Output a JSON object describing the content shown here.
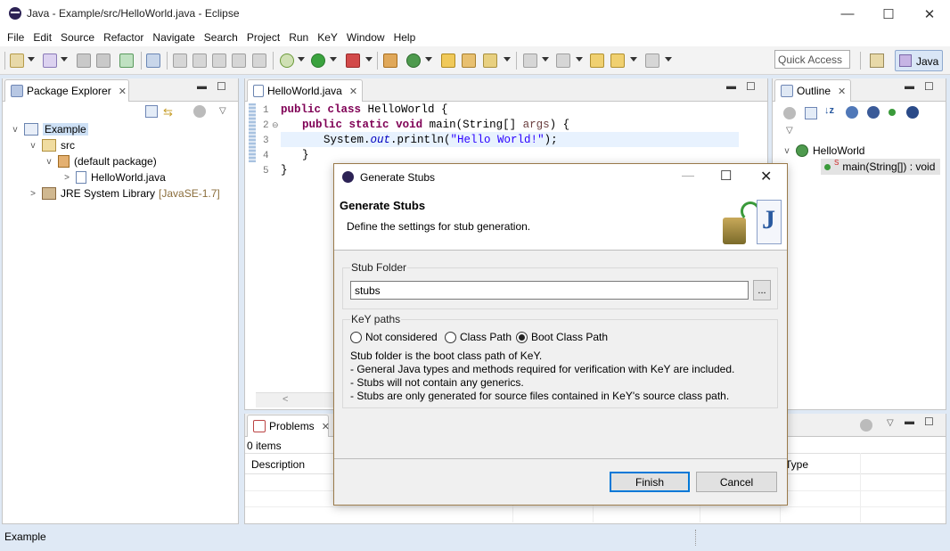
{
  "window": {
    "title": "Java - Example/src/HelloWorld.java - Eclipse",
    "minimize": "—",
    "maximize": "☐",
    "close": "✕"
  },
  "menu": [
    "File",
    "Edit",
    "Source",
    "Refactor",
    "Navigate",
    "Search",
    "Project",
    "Run",
    "KeY",
    "Window",
    "Help"
  ],
  "toolbar": {
    "quick_access_placeholder": "Quick Access",
    "perspective_label": "Java"
  },
  "package_explorer": {
    "tab_label": "Package Explorer",
    "tree": {
      "project": "Example",
      "src": "src",
      "package": "(default package)",
      "file": "HelloWorld.java",
      "jre": "JRE System Library",
      "jre_version": "[JavaSE-1.7]"
    }
  },
  "editor": {
    "tab_label": "HelloWorld.java",
    "line_numbers": [
      "1",
      "2",
      "3",
      "4",
      "5"
    ],
    "lines": {
      "l1_kw1": "public",
      "l1_kw2": "class",
      "l1_rest": " HelloWorld {",
      "l2_kw1": "public",
      "l2_kw2": "static",
      "l2_kw3": "void",
      "l2_mid": " main(String[] ",
      "l2_arg": "args",
      "l2_rest": ") {",
      "l3_a": "System.",
      "l3_out": "out",
      "l3_b": ".println(",
      "l3_str": "\"Hello World!\"",
      "l3_c": ");",
      "l4": "}",
      "l5": "}"
    }
  },
  "outline": {
    "tab_label": "Outline",
    "class_name": "HelloWorld",
    "method_name": "main(String[]) : void"
  },
  "problems": {
    "tab_label": "Problems",
    "count": "0 items",
    "columns": [
      "Description",
      "Type"
    ]
  },
  "status": {
    "text": "Example"
  },
  "dialog": {
    "title": "Generate Stubs",
    "heading": "Generate Stubs",
    "subtitle": "Define the settings for stub generation.",
    "stub_folder_group": "Stub Folder",
    "stub_folder_value": "stubs",
    "browse_label": "...",
    "key_paths_group": "KeY paths",
    "radios": [
      {
        "label": "Not considered",
        "selected": false
      },
      {
        "label": "Class Path",
        "selected": false
      },
      {
        "label": "Boot Class Path",
        "selected": true
      }
    ],
    "info": [
      "Stub folder is the boot class path of KeY.",
      "- General Java types and methods required for verification with KeY are included.",
      "- Stubs will not contain any generics.",
      "- Stubs are only generated for source files contained in KeY's source class path."
    ],
    "finish_label": "Finish",
    "cancel_label": "Cancel"
  },
  "colors": {
    "accent": "#0078d7",
    "keyword": "#7f0055",
    "string": "#2a00ff",
    "field": "#0000c0"
  }
}
